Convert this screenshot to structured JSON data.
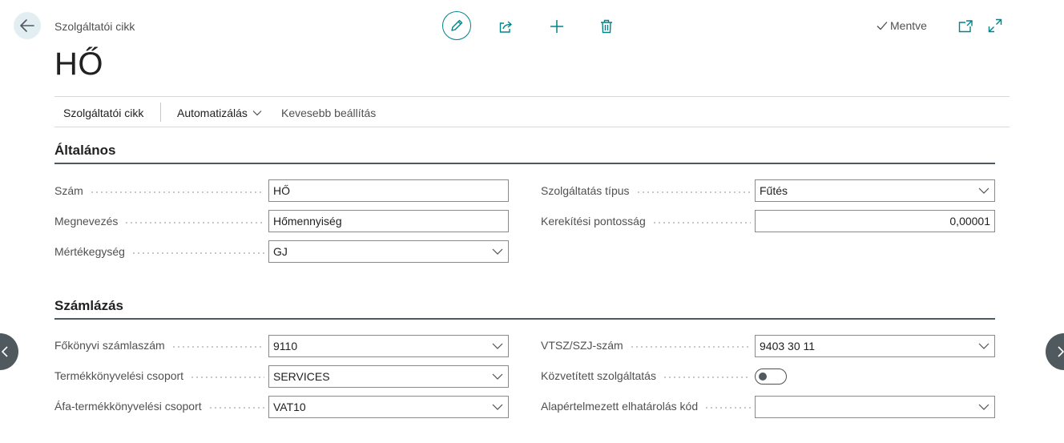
{
  "header": {
    "breadcrumb": "Szolgáltatói cikk",
    "title": "HŐ",
    "saved_label": "Mentve"
  },
  "actionbar": {
    "items": [
      "Szolgáltatói cikk",
      "Automatizálás",
      "Kevesebb beállítás"
    ]
  },
  "sections": {
    "general": {
      "title": "Általános",
      "fields": {
        "number": {
          "label": "Szám",
          "value": "HŐ"
        },
        "description": {
          "label": "Megnevezés",
          "value": "Hőmennyiség"
        },
        "uom": {
          "label": "Mértékegység",
          "value": "GJ"
        },
        "service_type": {
          "label": "Szolgáltatás típus",
          "value": "Fűtés"
        },
        "rounding": {
          "label": "Kerekítési pontosság",
          "value": "0,00001"
        }
      }
    },
    "invoicing": {
      "title": "Számlázás",
      "fields": {
        "gl_account": {
          "label": "Főkönyvi számlaszám",
          "value": "9110"
        },
        "gen_prod_group": {
          "label": "Termékkönyvelési csoport",
          "value": "SERVICES"
        },
        "vat_prod_group": {
          "label": "Áfa-termékkönyvelési csoport",
          "value": "VAT10"
        },
        "tariff_no": {
          "label": "VTSZ/SZJ-szám",
          "value": "9403 30 11"
        },
        "mediated": {
          "label": "Közvetített szolgáltatás",
          "value": false
        },
        "deferral": {
          "label": "Alapértelmezett elhatárolás kód",
          "value": ""
        }
      }
    }
  },
  "colors": {
    "accent": "#008489",
    "text": "#212121",
    "muted": "#505050",
    "nav": "#505a5e"
  }
}
